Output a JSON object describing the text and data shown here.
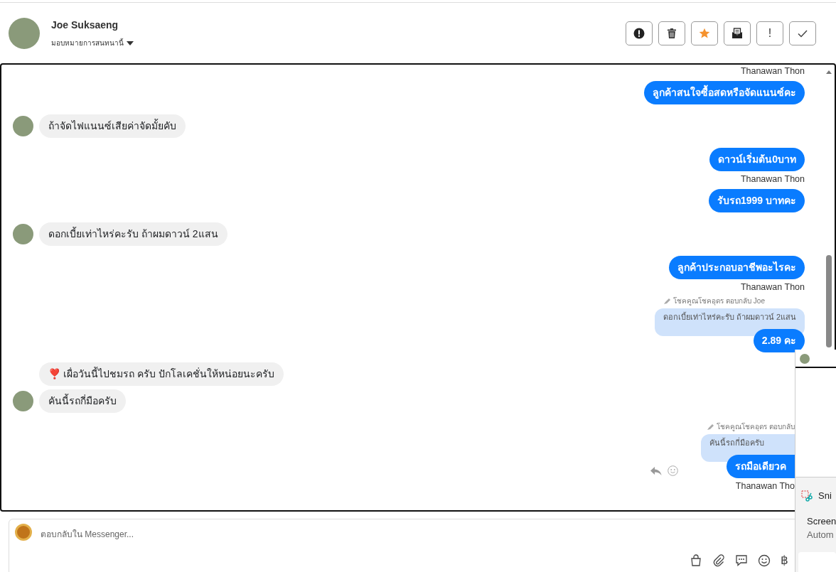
{
  "header": {
    "name": "Joe Suksaeng",
    "assign_label": "มอบหมายการสนทนานี้",
    "actions": [
      {
        "kind": "alert"
      },
      {
        "kind": "trash"
      },
      {
        "kind": "star"
      },
      {
        "kind": "mail"
      },
      {
        "kind": "text",
        "label": "!"
      },
      {
        "kind": "check"
      }
    ]
  },
  "messages": [
    {
      "kind": "sender",
      "text": "Thanawan Thon"
    },
    {
      "kind": "outgoing",
      "text": "ลูกค้าสนใจซื้อสดหรือจัดแนนซ์คะ",
      "clipped": false
    },
    {
      "kind": "incoming",
      "text": "ถ้าจัดไฟแนนซ์เสียค่าจัดมั้ยคับ",
      "avatar": true
    },
    {
      "kind": "outgoing",
      "text": "ดาวน์เริ่มต้น0บาท",
      "clipped": false
    },
    {
      "kind": "sender",
      "text": "Thanawan Thon"
    },
    {
      "kind": "outgoing",
      "text": "รับรถ1999 บาทคะ",
      "clipped": false
    },
    {
      "kind": "incoming",
      "text": "ดอกเบี้ยเท่าไหร่คะรับ ถ้าผมดาวน์ 2แสน",
      "avatar": true
    },
    {
      "kind": "outgoing",
      "text": "ลูกค้าประกอบอาชีพอะไรคะ",
      "clipped": false
    },
    {
      "kind": "sender",
      "text": "Thanawan Thon"
    },
    {
      "kind": "reply",
      "label": "โชคคูณโชคอุดร ตอบกลับ Joe",
      "quoted": "ดอกเบี้ยเท่าไหร่คะรับ ถ้าผมดาวน์ 2แสน",
      "text": "2.89 คะ",
      "clipped": false,
      "actions": false
    },
    {
      "kind": "incoming",
      "text": "❣️ เผื่อวันนี้ไปชมรถ ครับ ปักโลเคชั่นให้หน่อยนะครับ",
      "avatar": false
    },
    {
      "kind": "incoming",
      "text": "คันนี้รถกี่มือครับ",
      "avatar": true
    },
    {
      "kind": "reply",
      "label": "โชคคูณโชคอุดร ตอบกลับ",
      "quoted": "คันนี้รถกี่มือครับ",
      "text": "รถมือเดียวค",
      "clipped": true,
      "actions": true
    },
    {
      "kind": "sender",
      "text": "Thanawan Tho"
    }
  ],
  "composer": {
    "placeholder": "ตอบกลับใน Messenger...",
    "currency_symbol": "฿"
  },
  "notification": {
    "app": "Sni",
    "title": "Screen",
    "subtitle": "Autom"
  }
}
